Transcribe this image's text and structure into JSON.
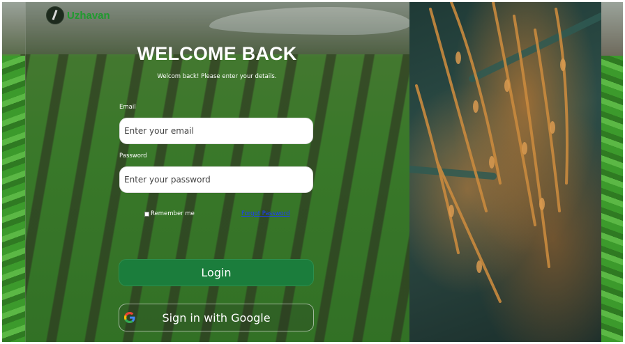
{
  "brand": {
    "name": "Uzhavan",
    "logo_icon": "farmer-logo-icon"
  },
  "login": {
    "title": "WELCOME BACK",
    "subtitle": "Welcom back! Please enter your details.",
    "email_label": "Email",
    "email_placeholder": "Enter your email",
    "password_label": "Password",
    "password_placeholder": "Enter your password",
    "remember_label": "Remember me",
    "forgot_label": "Forgot Password",
    "login_button": "Login",
    "google_button": "Sign in with Google",
    "google_icon": "google-icon"
  },
  "colors": {
    "brand_green": "#1f9a2e",
    "login_button": "#1b7d3c",
    "link": "#1a3cff"
  }
}
